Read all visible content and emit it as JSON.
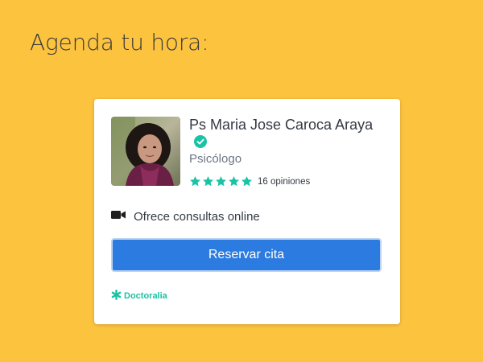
{
  "page": {
    "heading": "Agenda tu hora:",
    "background_color": "#fcc33f"
  },
  "doctor": {
    "name": "Ps Maria Jose Caroca Araya",
    "specialty": "Psicólogo",
    "verified": true,
    "rating_stars": 5,
    "reviews_label": "16 opiniones",
    "photo_icon": "doctor-photo"
  },
  "online": {
    "icon": "video-camera-icon",
    "label": "Ofrece consultas online"
  },
  "actions": {
    "book_label": "Reservar cita"
  },
  "brand": {
    "name": "Doctoralia",
    "icon": "asterisk-logo-icon"
  },
  "colors": {
    "accent": "#2c7be0",
    "star": "#19c3a3",
    "verified": "#19c3a3",
    "brand": "#19c3a3"
  }
}
